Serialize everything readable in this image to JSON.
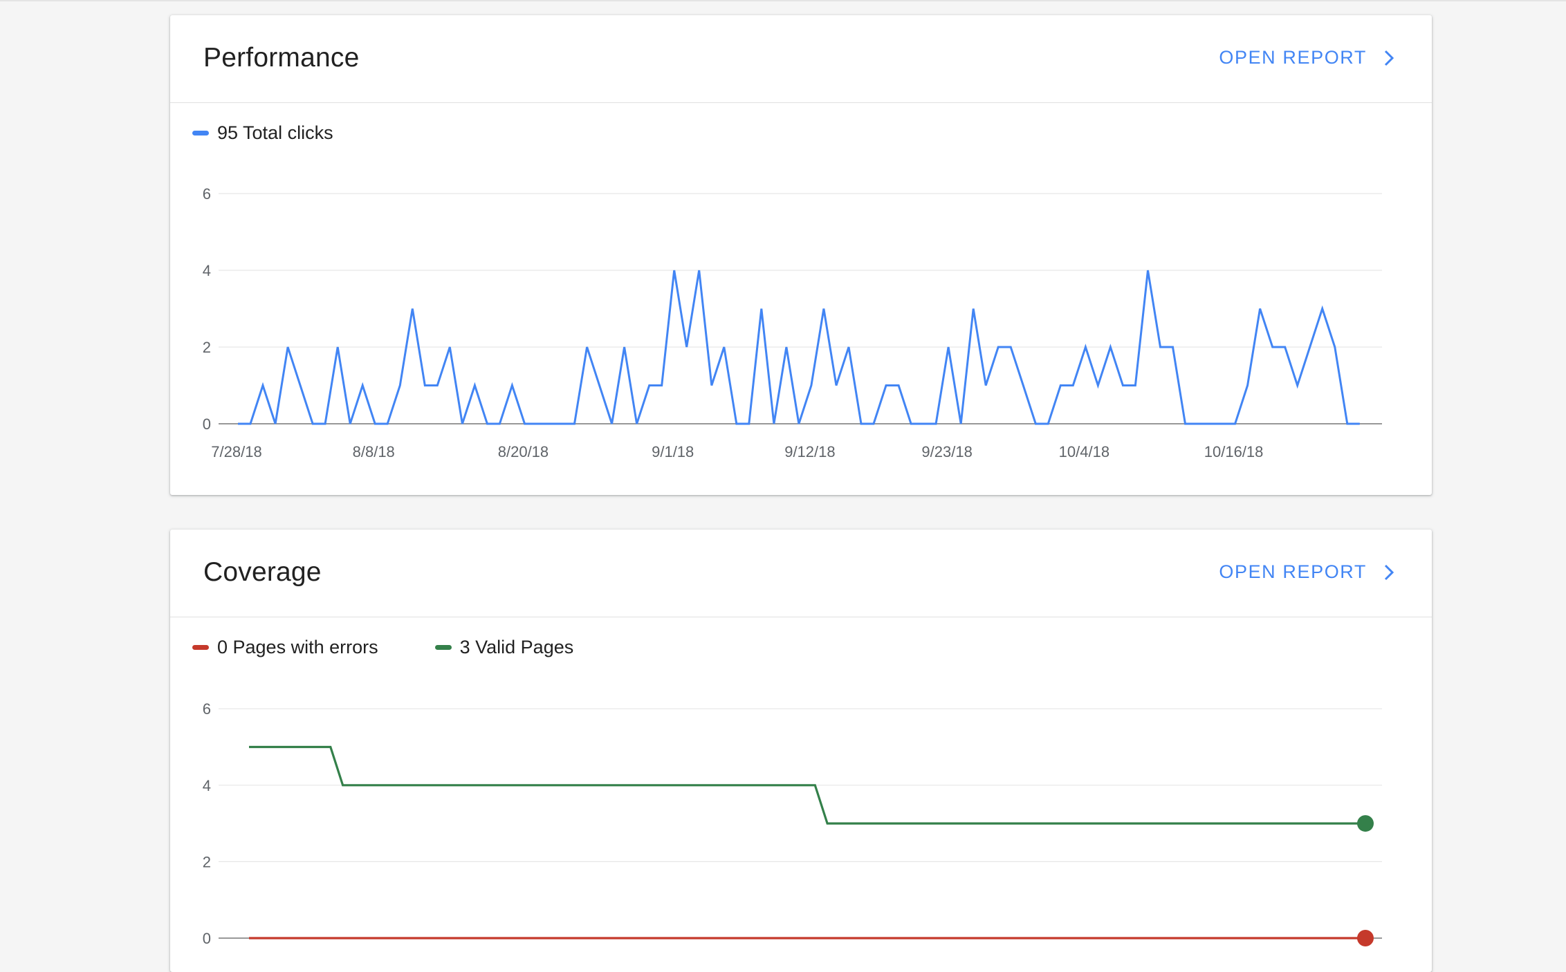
{
  "colors": {
    "clicks": "#4285f4",
    "errors": "#c5392b",
    "valid": "#34804a",
    "grid": "#e6e6e6",
    "axis": "#777777"
  },
  "performance": {
    "title": "Performance",
    "open_report_label": "OPEN REPORT",
    "chevron_icon": "chevron-right-icon",
    "legend_clicks": "95 Total clicks"
  },
  "coverage": {
    "title": "Coverage",
    "open_report_label": "OPEN REPORT",
    "chevron_icon": "chevron-right-icon",
    "legend_errors": "0 Pages with errors",
    "legend_valid": "3 Valid Pages"
  },
  "chart_data": [
    {
      "type": "line",
      "ylim": [
        0,
        6
      ],
      "y_ticks": [
        "0",
        "2",
        "4",
        "6"
      ],
      "x_tick_labels": [
        "7/28/18",
        "8/8/18",
        "8/20/18",
        "9/1/18",
        "9/12/18",
        "9/23/18",
        "10/4/18",
        "10/16/18"
      ],
      "x_tick_positions": [
        0,
        11,
        23,
        35,
        46,
        57,
        68,
        80
      ],
      "grid": true,
      "legend_position": "top-left",
      "series": [
        {
          "name": "95 Total clicks",
          "values": [
            0,
            0,
            1,
            0,
            2,
            1,
            0,
            0,
            2,
            0,
            1,
            0,
            0,
            1,
            3,
            1,
            1,
            2,
            0,
            1,
            0,
            0,
            1,
            0,
            0,
            0,
            0,
            0,
            2,
            1,
            0,
            2,
            0,
            1,
            1,
            4,
            2,
            4,
            1,
            2,
            0,
            0,
            3,
            0,
            2,
            0,
            1,
            3,
            1,
            2,
            0,
            0,
            1,
            1,
            0,
            0,
            0,
            2,
            0,
            3,
            1,
            2,
            2,
            1,
            0,
            0,
            1,
            1,
            2,
            1,
            2,
            1,
            1,
            4,
            2,
            2,
            0,
            0,
            0,
            0,
            0,
            1,
            3,
            2,
            2,
            1,
            2,
            3,
            2,
            0,
            0
          ]
        }
      ]
    },
    {
      "type": "line",
      "ylim": [
        0,
        6
      ],
      "y_ticks": [
        "0",
        "2",
        "4",
        "6"
      ],
      "grid": true,
      "legend_position": "top-left",
      "series": [
        {
          "name": "3 Valid Pages",
          "points": [
            [
              0,
              5
            ],
            [
              0.073,
              5
            ],
            [
              0.084,
              4
            ],
            [
              0.507,
              4
            ],
            [
              0.518,
              3
            ],
            [
              1.0,
              3
            ]
          ]
        },
        {
          "name": "0 Pages with errors",
          "points": [
            [
              0,
              0
            ],
            [
              1.0,
              0
            ]
          ]
        }
      ]
    }
  ]
}
